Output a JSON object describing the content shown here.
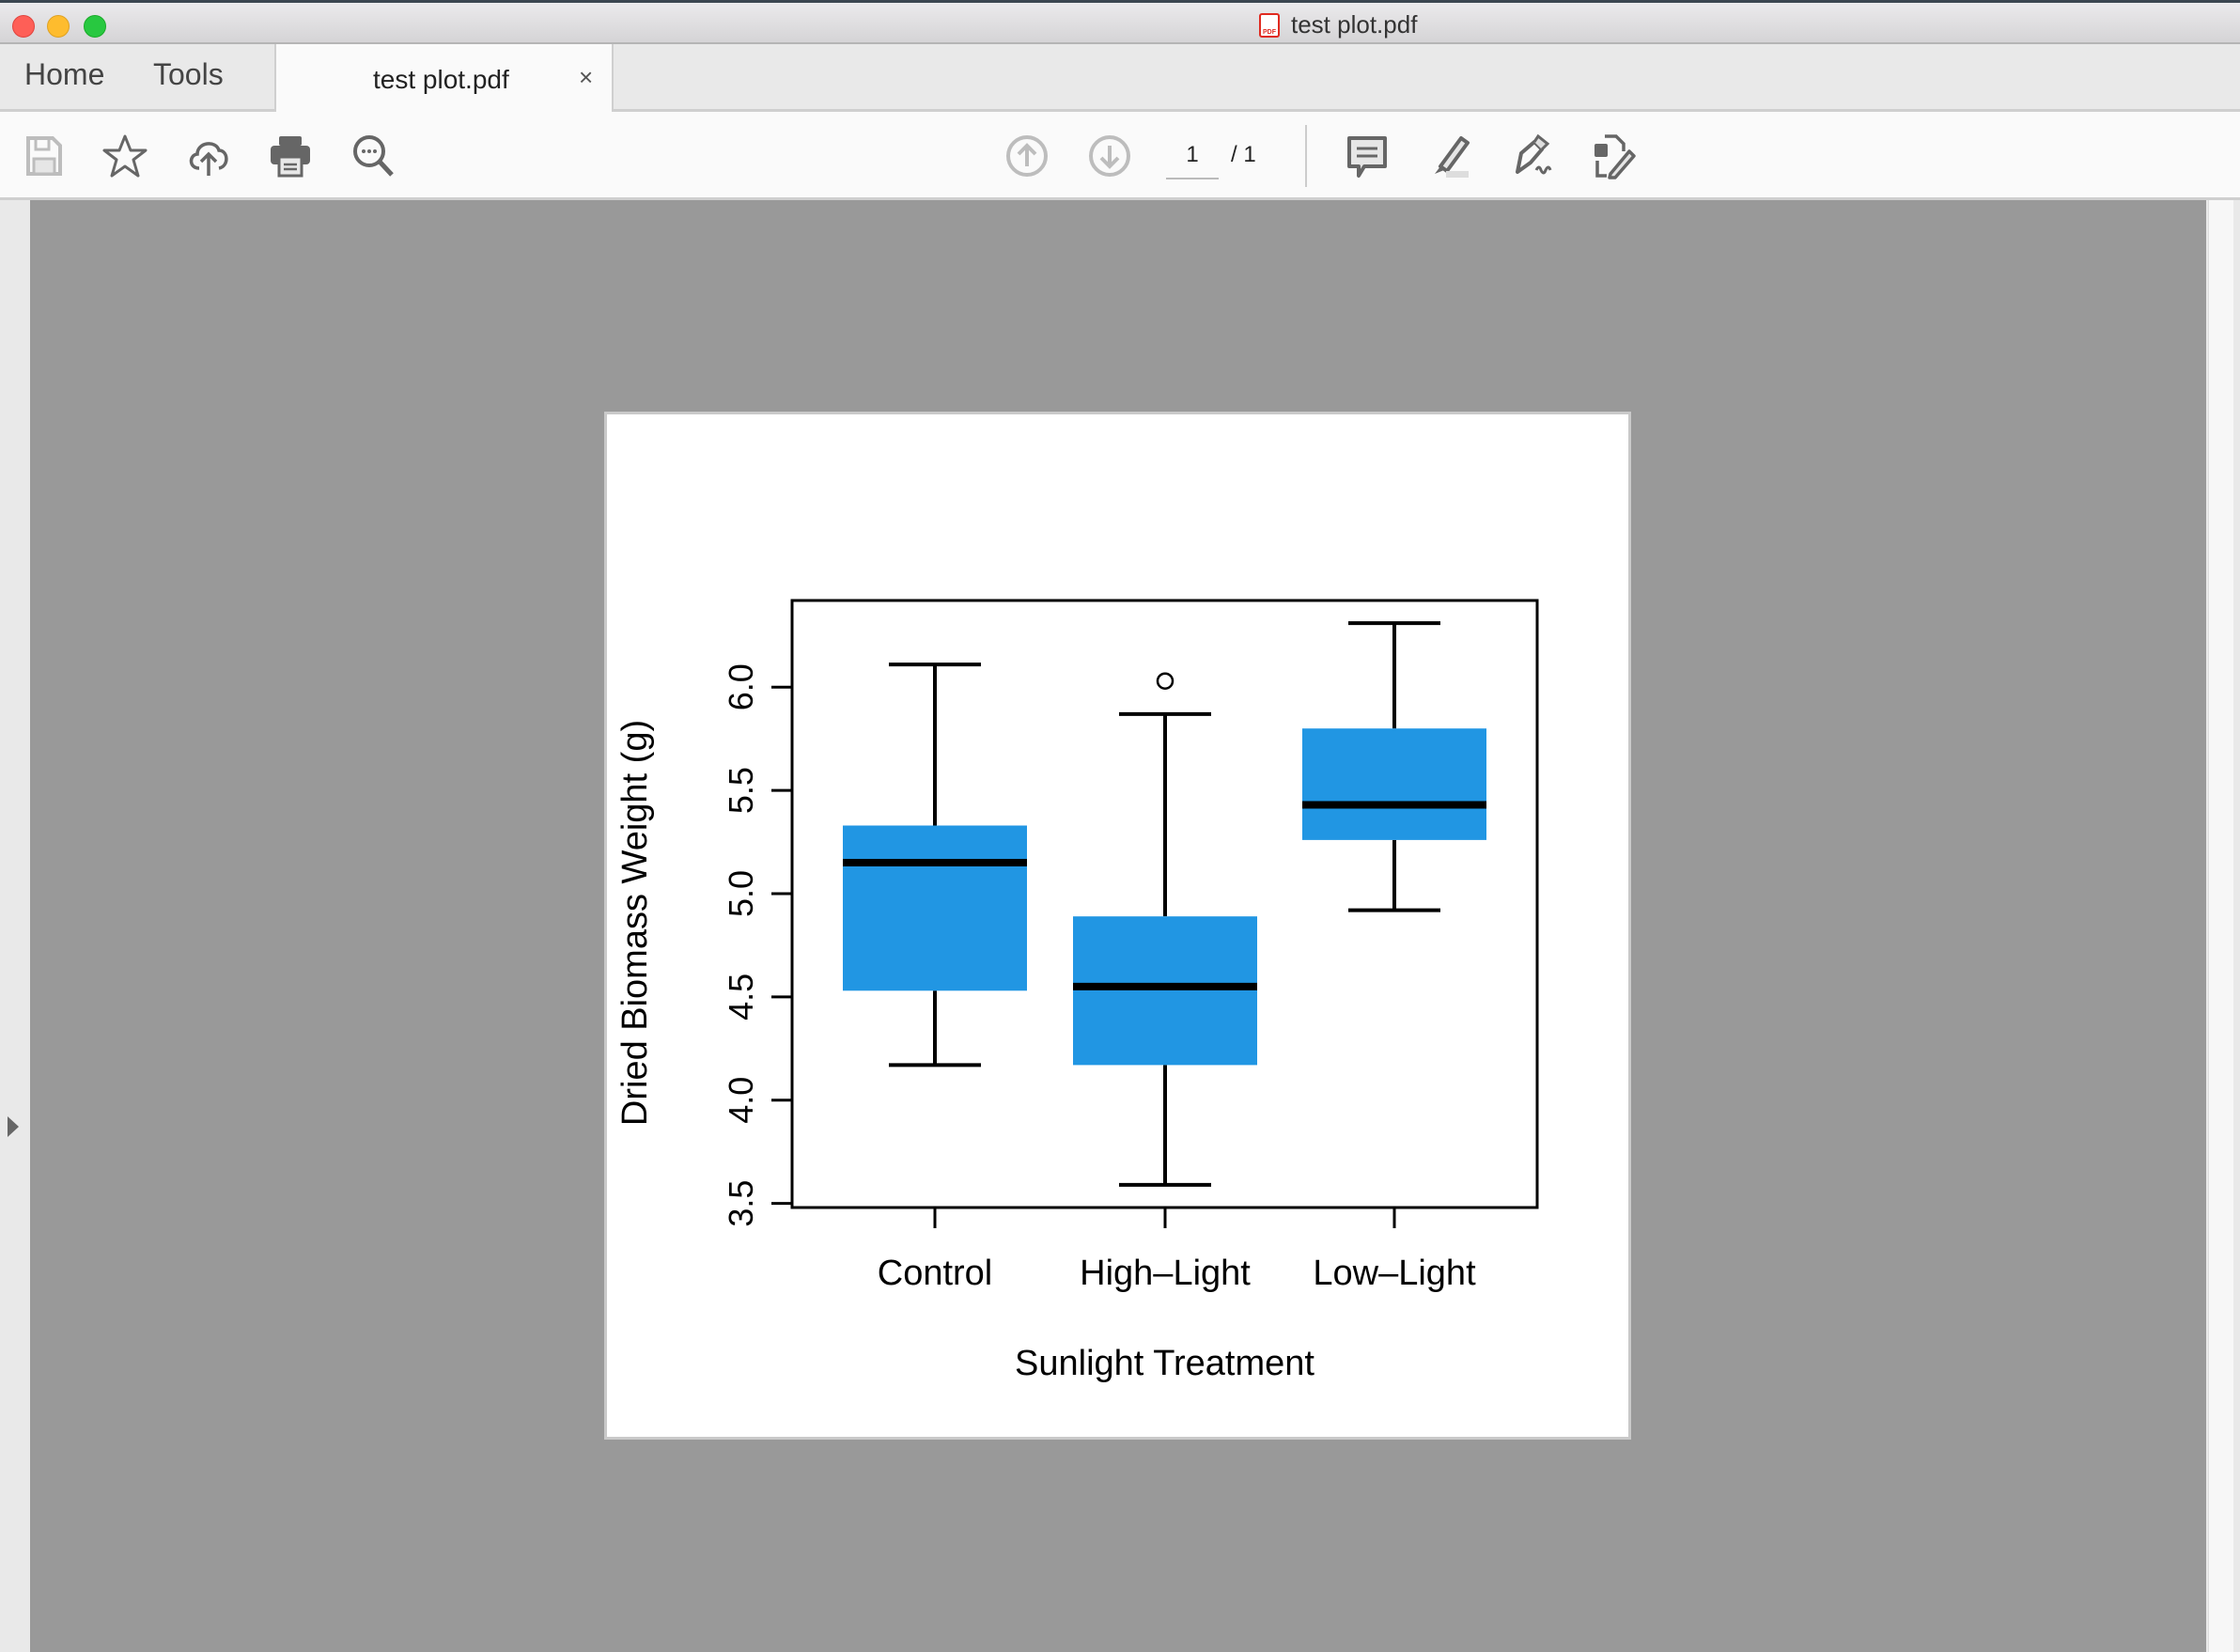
{
  "window": {
    "title": "test plot.pdf",
    "file_icon": "pdf-file-icon"
  },
  "tabs": {
    "home_label": "Home",
    "tools_label": "Tools",
    "document_tab_label": "test plot.pdf",
    "close_label": "×"
  },
  "toolbar": {
    "left_icons": [
      "save-icon",
      "bookmark-star-icon",
      "cloud-upload-icon",
      "print-icon",
      "zoom-search-icon"
    ],
    "nav_icons": [
      "previous-page-icon",
      "next-page-icon"
    ],
    "current_page": "1",
    "page_total": "/ 1",
    "right_icons": [
      "comment-icon",
      "highlight-icon",
      "sign-icon",
      "edit-pdf-icon"
    ]
  },
  "colors": {
    "box_fill": "#2196e3",
    "accent_pdf": "#e02a20"
  },
  "chart_data": {
    "type": "boxplot",
    "title": "",
    "xlabel": "Sunlight Treatment",
    "ylabel": "Dried Biomass Weight (g)",
    "ylim": [
      3.48,
      6.42
    ],
    "yticks": [
      3.5,
      4.0,
      4.5,
      5.0,
      5.5,
      6.0
    ],
    "ytick_labels": [
      "3.5",
      "4.0",
      "4.5",
      "5.0",
      "5.5",
      "6.0"
    ],
    "categories": [
      "Control",
      "High–Light",
      "Low–Light"
    ],
    "series": [
      {
        "name": "Control",
        "whisker_low": 4.17,
        "q1": 4.53,
        "median": 5.15,
        "q3": 5.33,
        "whisker_high": 6.11,
        "outliers": []
      },
      {
        "name": "High–Light",
        "whisker_low": 3.59,
        "q1": 4.17,
        "median": 4.55,
        "q3": 4.89,
        "whisker_high": 5.87,
        "outliers": [
          6.03
        ]
      },
      {
        "name": "Low–Light",
        "whisker_low": 4.92,
        "q1": 5.26,
        "median": 5.43,
        "q3": 5.8,
        "whisker_high": 6.31,
        "outliers": []
      }
    ],
    "grid": false,
    "legend": "none"
  }
}
